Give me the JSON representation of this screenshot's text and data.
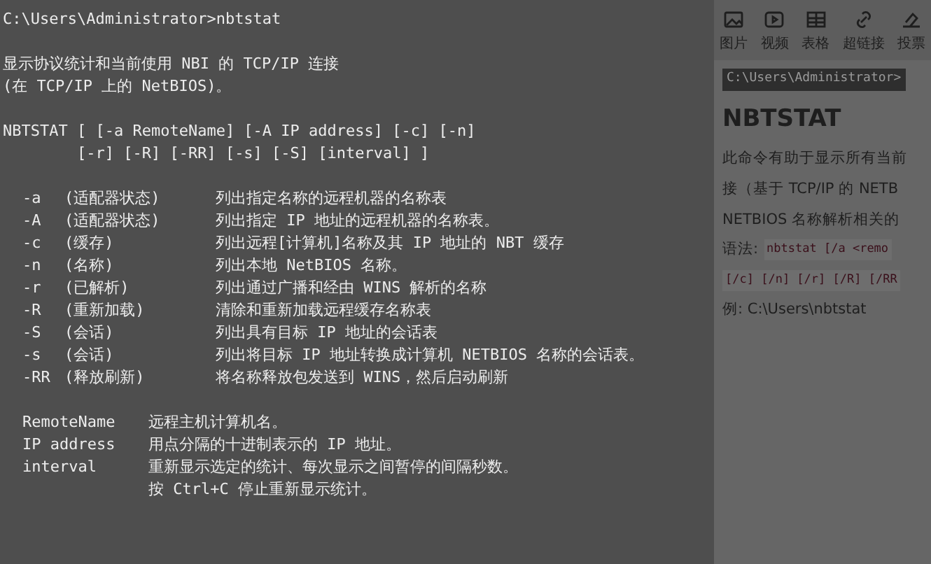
{
  "console": {
    "prompt": "C:\\Users\\Administrator>nbtstat",
    "description": [
      "显示协议统计和当前使用 NBI 的 TCP/IP 连接",
      "(在 TCP/IP 上的 NetBIOS)。"
    ],
    "usage": [
      "NBTSTAT [ [-a RemoteName] [-A IP address] [-c] [-n]",
      "        [-r] [-R] [-RR] [-s] [-S] [interval] ]"
    ],
    "options": [
      {
        "flag": "-a",
        "label": "(适配器状态)",
        "desc": "列出指定名称的远程机器的名称表"
      },
      {
        "flag": "-A",
        "label": "(适配器状态)",
        "desc": "列出指定 IP 地址的远程机器的名称表。"
      },
      {
        "flag": "-c",
        "label": "(缓存)",
        "desc": "列出远程[计算机]名称及其 IP 地址的 NBT 缓存"
      },
      {
        "flag": "-n",
        "label": "(名称)",
        "desc": "列出本地 NetBIOS 名称。"
      },
      {
        "flag": "-r",
        "label": "(已解析)",
        "desc": "列出通过广播和经由 WINS 解析的名称"
      },
      {
        "flag": "-R",
        "label": "(重新加载)",
        "desc": "清除和重新加载远程缓存名称表"
      },
      {
        "flag": "-S",
        "label": "(会话)",
        "desc": "列出具有目标 IP 地址的会话表"
      },
      {
        "flag": "-s",
        "label": "(会话)",
        "desc": "列出将目标 IP 地址转换成计算机 NETBIOS 名称的会话表。"
      },
      {
        "flag": "-RR",
        "label": "(释放刷新)",
        "desc": "将名称释放包发送到 WINS，然后启动刷新"
      }
    ],
    "params": [
      {
        "name": "RemoteName",
        "desc": "远程主机计算机名。"
      },
      {
        "name": "IP address",
        "desc": "用点分隔的十进制表示的 IP 地址。"
      },
      {
        "name": "interval",
        "desc": "重新显示选定的统计、每次显示之间暂停的间隔秒数。"
      },
      {
        "desc": "按 Ctrl+C 停止重新显示统计。"
      }
    ]
  },
  "editor": {
    "toolbar": [
      {
        "kind": "image",
        "label": "图片"
      },
      {
        "kind": "video",
        "label": "视频"
      },
      {
        "kind": "table",
        "label": "表格"
      },
      {
        "kind": "link",
        "label": "超链接"
      },
      {
        "kind": "vote",
        "label": "投票"
      }
    ],
    "preview": {
      "code_line": "C:\\Users\\Administrator>",
      "heading": "NBTSTAT",
      "paragraphs": [
        "此命令有助于显示所有当前",
        "接（基于 TCP/IP 的 NETB",
        "NETBIOS 名称解析相关的"
      ],
      "syntax_label": "语法:",
      "syntax_code": [
        "nbtstat [/a <remo",
        "[/c] [/n] [/r] [/R] [/RR"
      ],
      "example": "例:  C:\\Users\\nbtstat"
    }
  }
}
